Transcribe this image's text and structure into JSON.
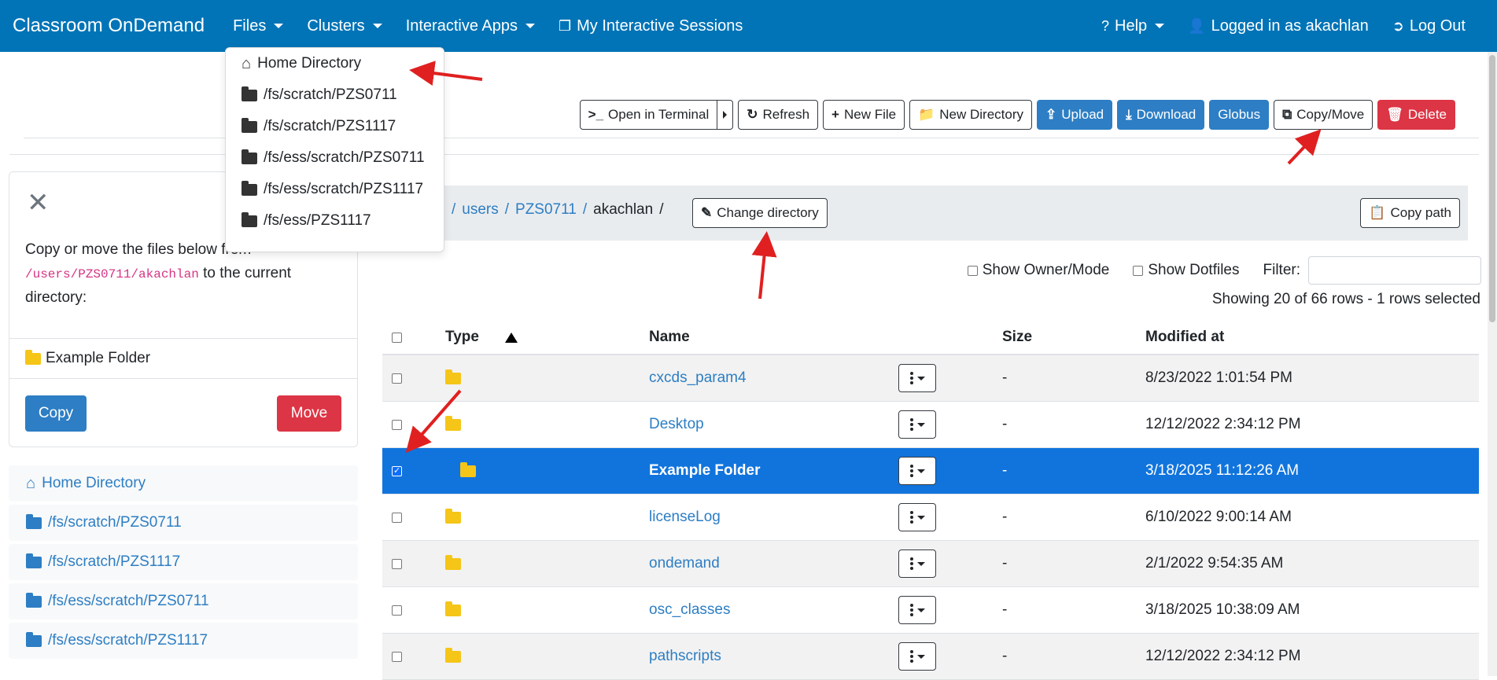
{
  "navbar": {
    "brand": "Classroom OnDemand",
    "files": "Files",
    "clusters": "Clusters",
    "interactive_apps": "Interactive Apps",
    "sessions": "My Interactive Sessions",
    "help": "Help",
    "user": "Logged in as akachlan",
    "logout": "Log Out"
  },
  "files_dropdown": {
    "items": [
      {
        "label": "Home Directory",
        "icon": "home-icon"
      },
      {
        "label": "/fs/scratch/PZS0711",
        "icon": "folder-icon"
      },
      {
        "label": "/fs/scratch/PZS1117",
        "icon": "folder-icon"
      },
      {
        "label": "/fs/ess/scratch/PZS0711",
        "icon": "folder-icon"
      },
      {
        "label": "/fs/ess/scratch/PZS1117",
        "icon": "folder-icon"
      },
      {
        "label": "/fs/ess/PZS1117",
        "icon": "folder-icon"
      }
    ]
  },
  "toolbar": {
    "open_terminal": "Open in Terminal",
    "refresh": "Refresh",
    "new_file": "New File",
    "new_directory": "New Directory",
    "upload": "Upload",
    "download": "Download",
    "globus": "Globus",
    "copy_move": "Copy/Move",
    "delete": "Delete"
  },
  "breadcrumb": {
    "parts": [
      "users",
      "PZS0711",
      "akachlan"
    ],
    "change_directory": "Change directory",
    "copy_path": "Copy path"
  },
  "filters": {
    "show_owner_mode": "Show Owner/Mode",
    "show_dotfiles": "Show Dotfiles",
    "filter_label": "Filter:",
    "filter_value": "",
    "showing": "Showing 20 of 66 rows - 1 rows selected"
  },
  "table": {
    "headers": {
      "type": "Type",
      "name": "Name",
      "size": "Size",
      "modified": "Modified at"
    },
    "rows": [
      {
        "name": "cxcds_param4",
        "size": "-",
        "modified": "8/23/2022 1:01:54 PM",
        "selected": false
      },
      {
        "name": "Desktop",
        "size": "-",
        "modified": "12/12/2022 2:34:12 PM",
        "selected": false
      },
      {
        "name": "Example Folder",
        "size": "-",
        "modified": "3/18/2025 11:12:26 AM",
        "selected": true
      },
      {
        "name": "licenseLog",
        "size": "-",
        "modified": "6/10/2022 9:00:14 AM",
        "selected": false
      },
      {
        "name": "ondemand",
        "size": "-",
        "modified": "2/1/2022 9:54:35 AM",
        "selected": false
      },
      {
        "name": "osc_classes",
        "size": "-",
        "modified": "3/18/2025 10:38:09 AM",
        "selected": false
      },
      {
        "name": "pathscripts",
        "size": "-",
        "modified": "12/12/2022 2:34:12 PM",
        "selected": false
      }
    ]
  },
  "copy_move_panel": {
    "text_before": "Copy or move the files below from ",
    "source_path": "/users/PZS0711/akachlan",
    "text_after": " to the current directory:",
    "item": "Example Folder",
    "copy": "Copy",
    "move": "Move"
  },
  "sidebar": {
    "items": [
      {
        "label": "Home Directory",
        "icon": "home-icon"
      },
      {
        "label": "/fs/scratch/PZS0711",
        "icon": "folder-icon"
      },
      {
        "label": "/fs/scratch/PZS1117",
        "icon": "folder-icon"
      },
      {
        "label": "/fs/ess/scratch/PZS0711",
        "icon": "folder-icon"
      },
      {
        "label": "/fs/ess/scratch/PZS1117",
        "icon": "folder-icon"
      }
    ]
  },
  "colors": {
    "navbar": "#0074b7",
    "primary": "#2d7ec4",
    "danger": "#dc3545",
    "selected_row": "#1174dd",
    "folder": "#f5c518",
    "annotation_arrow": "#e02020"
  }
}
